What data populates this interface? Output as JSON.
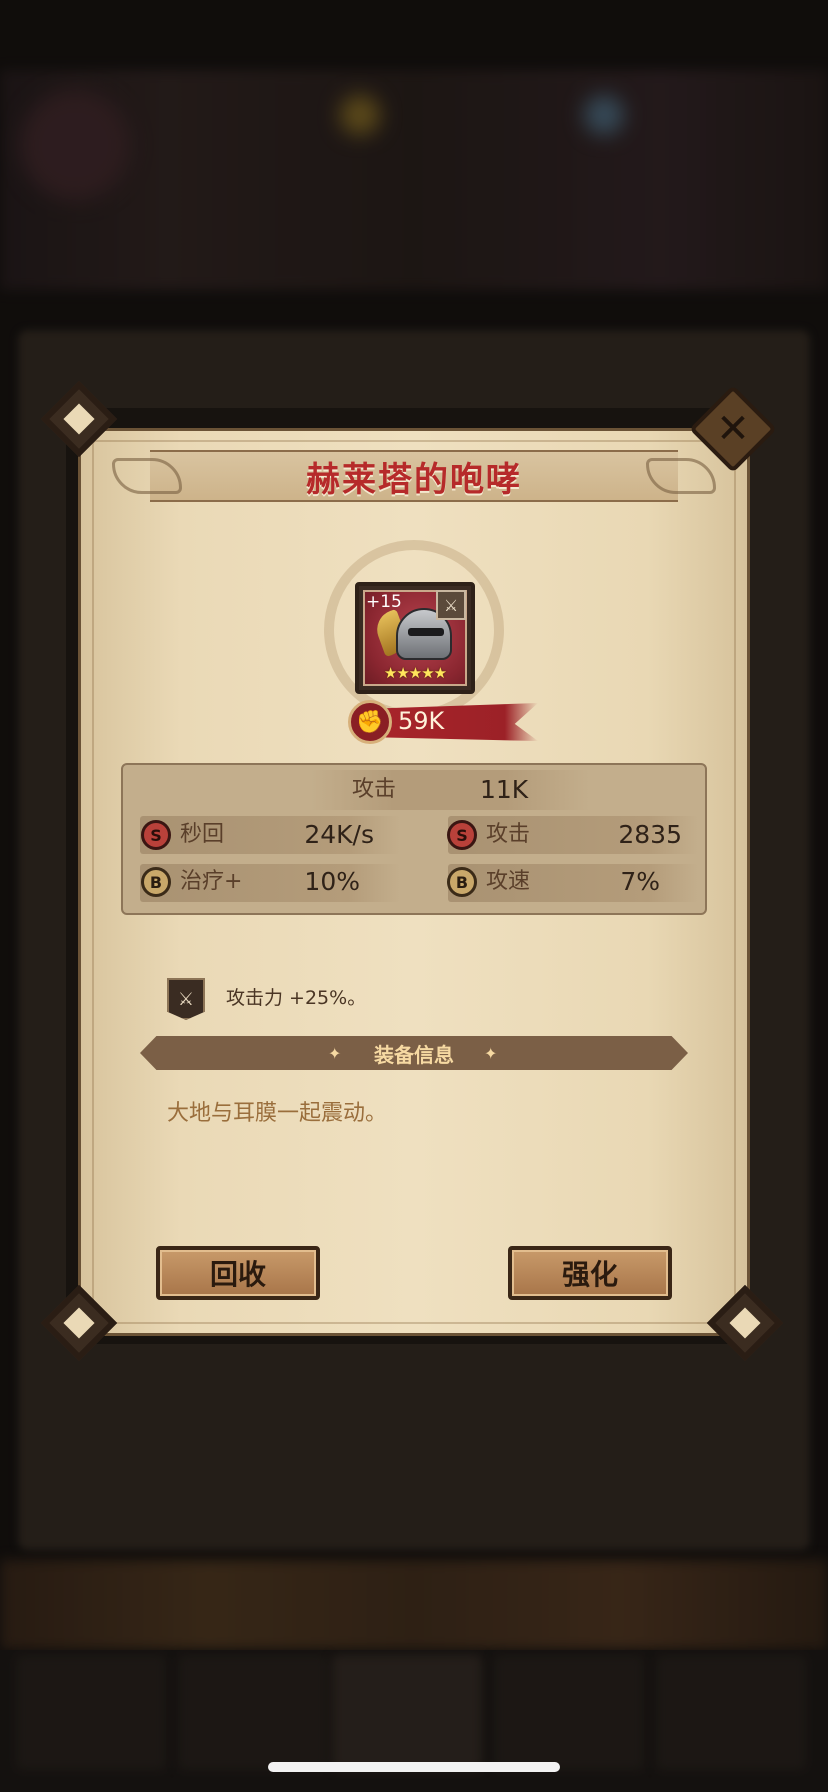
{
  "dialog": {
    "title": "赫莱塔的咆哮",
    "item": {
      "enhance_level": "+15",
      "stars": "★★★★★",
      "type_icon": "sword-icon",
      "power": "59K"
    },
    "main_stat": {
      "label": "攻击",
      "value": "11K"
    },
    "sub_stats": [
      {
        "grade": "S",
        "label": "秒回",
        "value": "24K/s"
      },
      {
        "grade": "S",
        "label": "攻击",
        "value": "2835"
      },
      {
        "grade": "B",
        "label": "治疗+",
        "value": "10%"
      },
      {
        "grade": "B",
        "label": "攻速",
        "value": "7%"
      }
    ],
    "passive": {
      "text": "攻击力 +25%。",
      "icon": "sword-icon"
    },
    "section_title": "装备信息",
    "description": "大地与耳膜一起震动。",
    "buttons": {
      "recycle": "回收",
      "enhance": "强化"
    },
    "close_icon": "close-icon"
  },
  "colors": {
    "title": "#b62a2a",
    "accent_red": "#a8242a",
    "paper": "#ead9b6"
  }
}
